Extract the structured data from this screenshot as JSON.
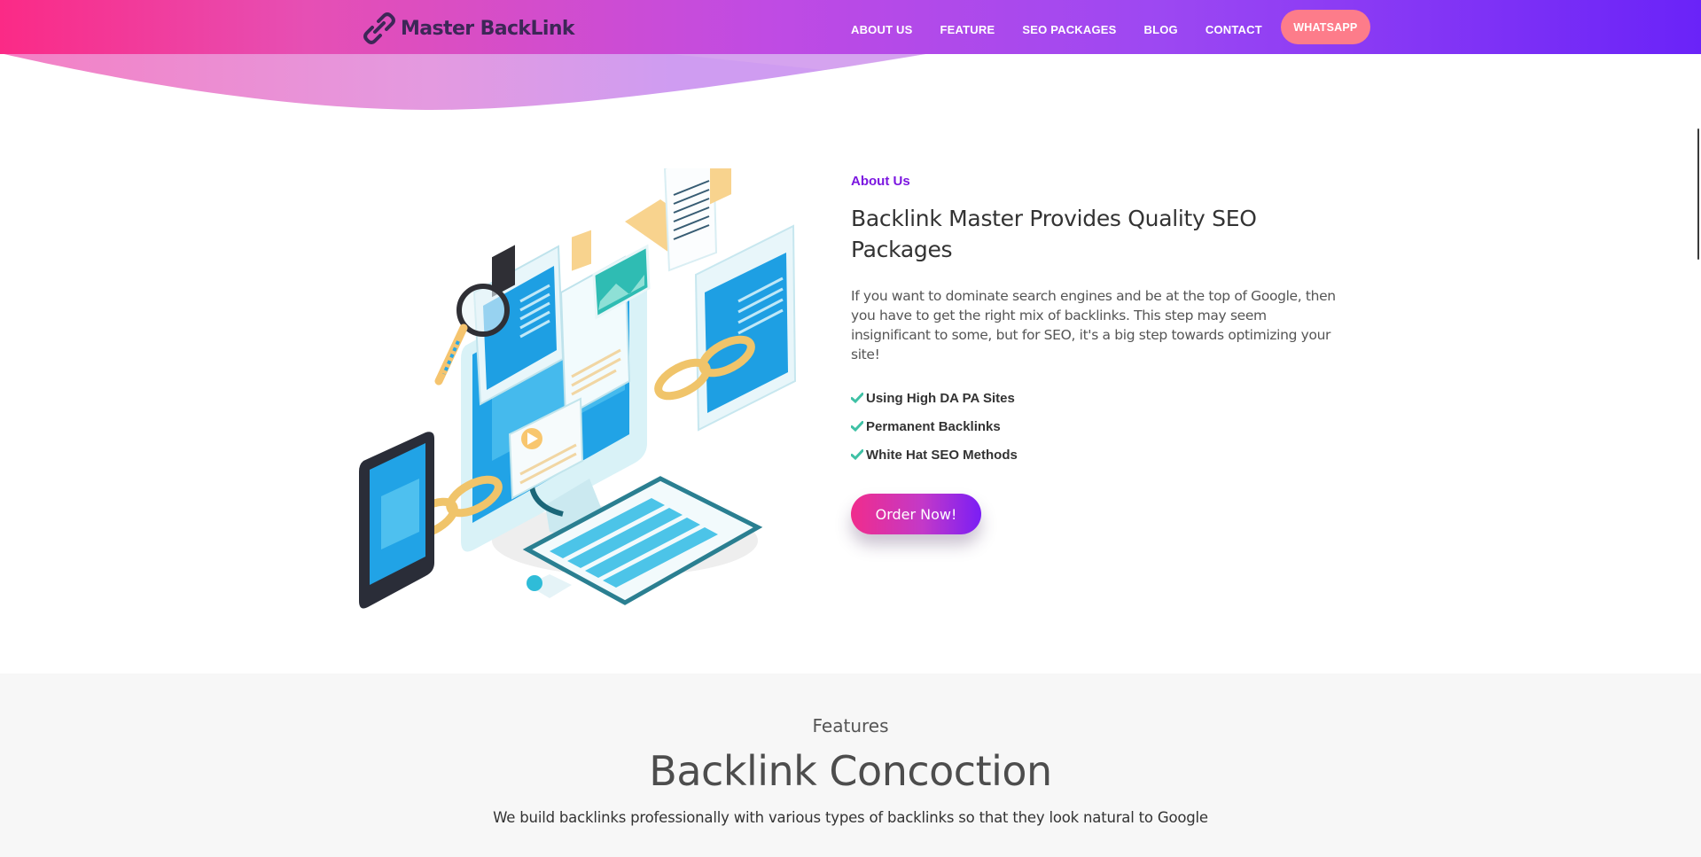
{
  "header": {
    "logo_text": "Master BackLink",
    "nav": [
      {
        "label": "ABOUT US"
      },
      {
        "label": "FEATURE"
      },
      {
        "label": "SEO PACKAGES"
      },
      {
        "label": "BLOG"
      },
      {
        "label": "CONTACT"
      }
    ],
    "whatsapp_label": "WHATSAPP",
    "gradient_colors": [
      "#fb2a86",
      "#c04be3",
      "#6a23f8"
    ]
  },
  "about": {
    "eyebrow": "About Us",
    "title": "Backlink Master Provides Quality SEO Packages",
    "description": "If you want to dominate search engines and be at the top of Google, then you have to get the right mix of backlinks. This step may seem insignificant to some, but for SEO, it's a big step towards optimizing your site!",
    "features": [
      {
        "label": "Using High DA PA Sites",
        "icon": "check-icon"
      },
      {
        "label": "Permanent Backlinks",
        "icon": "check-icon"
      },
      {
        "label": "White Hat SEO Methods",
        "icon": "check-icon"
      }
    ],
    "order_button": "Order Now!",
    "illustration_icon": "isometric-backlink-illustration"
  },
  "features_section": {
    "label": "Features",
    "title": "Backlink Concoction",
    "subtitle": "We build backlinks professionally with various types of backlinks so that they look natural to Google"
  },
  "colors": {
    "accent_purple": "#7b16e0",
    "check_green": "#3fc1a5",
    "whatsapp_pink": "#fd7c8a"
  }
}
